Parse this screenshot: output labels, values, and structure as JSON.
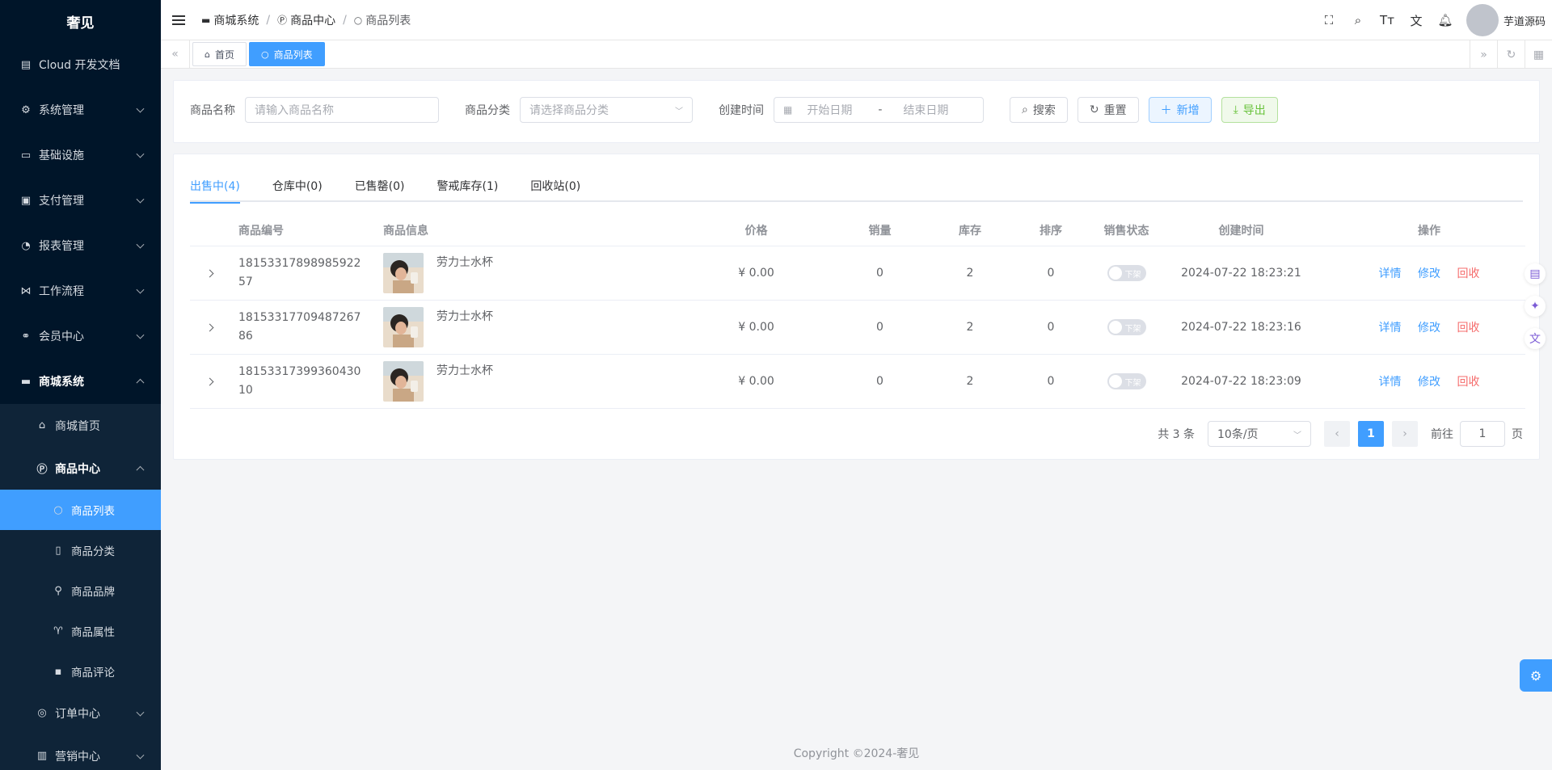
{
  "sidebar": {
    "logo": "奢见",
    "items": [
      {
        "label": "Cloud 开发文档",
        "icon": "doc-icon"
      },
      {
        "label": "系统管理",
        "icon": "gear-icon"
      },
      {
        "label": "基础设施",
        "icon": "monitor-icon"
      },
      {
        "label": "支付管理",
        "icon": "wallet-icon"
      },
      {
        "label": "报表管理",
        "icon": "pie-chart-icon"
      },
      {
        "label": "工作流程",
        "icon": "workflow-icon"
      },
      {
        "label": "会员中心",
        "icon": "bike-icon"
      },
      {
        "label": "商城系统",
        "icon": "shop-icon"
      }
    ],
    "mall": [
      {
        "label": "商城首页"
      },
      {
        "label": "商品中心"
      }
    ],
    "goods": [
      {
        "label": "商品列表"
      },
      {
        "label": "商品分类"
      },
      {
        "label": "商品品牌"
      },
      {
        "label": "商品属性"
      },
      {
        "label": "商品评论"
      }
    ],
    "after": [
      {
        "label": "订单中心"
      },
      {
        "label": "营销中心"
      }
    ]
  },
  "header": {
    "breadcrumb": [
      "商城系统",
      "商品中心",
      "商品列表"
    ],
    "username": "芋道源码"
  },
  "tags": {
    "home": "首页",
    "current": "商品列表"
  },
  "search": {
    "name_label": "商品名称",
    "name_placeholder": "请输入商品名称",
    "category_label": "商品分类",
    "category_placeholder": "请选择商品分类",
    "time_label": "创建时间",
    "start_placeholder": "开始日期",
    "range_sep": "-",
    "end_placeholder": "结束日期",
    "search_btn": "搜索",
    "reset_btn": "重置",
    "add_btn": "新增",
    "export_btn": "导出"
  },
  "tabs": [
    "出售中(4)",
    "仓库中(0)",
    "已售罄(0)",
    "警戒库存(1)",
    "回收站(0)"
  ],
  "table": {
    "headers": [
      "商品编号",
      "商品信息",
      "价格",
      "销量",
      "库存",
      "排序",
      "销售状态",
      "创建时间",
      "操作"
    ],
    "rows": [
      {
        "id": "1815331789898592257",
        "name": "劳力士水杯",
        "price": "¥ 0.00",
        "sales": "0",
        "stock": "2",
        "sort": "0",
        "status": "下架",
        "time": "2024-07-22 18:23:21"
      },
      {
        "id": "1815331770948726786",
        "name": "劳力士水杯",
        "price": "¥ 0.00",
        "sales": "0",
        "stock": "2",
        "sort": "0",
        "status": "下架",
        "time": "2024-07-22 18:23:16"
      },
      {
        "id": "1815331739936043010",
        "name": "劳力士水杯",
        "price": "¥ 0.00",
        "sales": "0",
        "stock": "2",
        "sort": "0",
        "status": "下架",
        "time": "2024-07-22 18:23:09"
      }
    ],
    "ops": {
      "detail": "详情",
      "edit": "修改",
      "recycle": "回收"
    }
  },
  "pagination": {
    "total": "共 3 条",
    "page_size": "10条/页",
    "current": "1",
    "goto_label": "前往",
    "goto_value": "1",
    "page_unit": "页"
  },
  "footer": "Copyright ©2024-奢见",
  "colors": {
    "primary": "#409eff",
    "sidebar": "#001529",
    "danger": "#f56c6c",
    "success": "#67c23a"
  }
}
